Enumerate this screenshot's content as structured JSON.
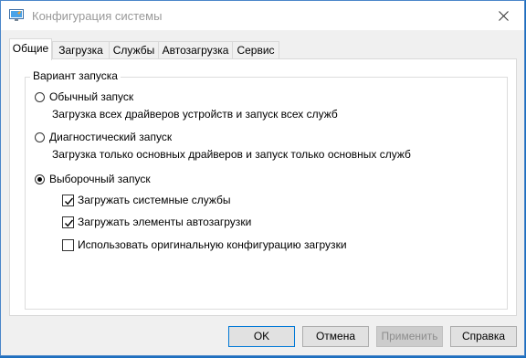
{
  "window": {
    "title": "Конфигурация системы"
  },
  "tabs": [
    {
      "label": "Общие",
      "active": true
    },
    {
      "label": "Загрузка",
      "active": false
    },
    {
      "label": "Службы",
      "active": false
    },
    {
      "label": "Автозагрузка",
      "active": false
    },
    {
      "label": "Сервис",
      "active": false
    }
  ],
  "startup": {
    "legend": "Вариант запуска",
    "normal": {
      "label": "Обычный запуск",
      "description": "Загрузка всех драйверов устройств и запуск всех служб",
      "selected": false
    },
    "diagnostic": {
      "label": "Диагностический запуск",
      "description": "Загрузка только основных драйверов и запуск только основных служб",
      "selected": false
    },
    "selective": {
      "label": "Выборочный запуск",
      "selected": true,
      "options": [
        {
          "label": "Загружать системные службы",
          "checked": true
        },
        {
          "label": "Загружать элементы автозагрузки",
          "checked": true
        },
        {
          "label": "Использовать оригинальную конфигурацию загрузки",
          "checked": false
        }
      ]
    }
  },
  "buttons": {
    "ok": "OK",
    "cancel": "Отмена",
    "apply": "Применить",
    "help": "Справка"
  },
  "colors": {
    "accent": "#0078d7",
    "desktop": "#1e6fbe"
  }
}
